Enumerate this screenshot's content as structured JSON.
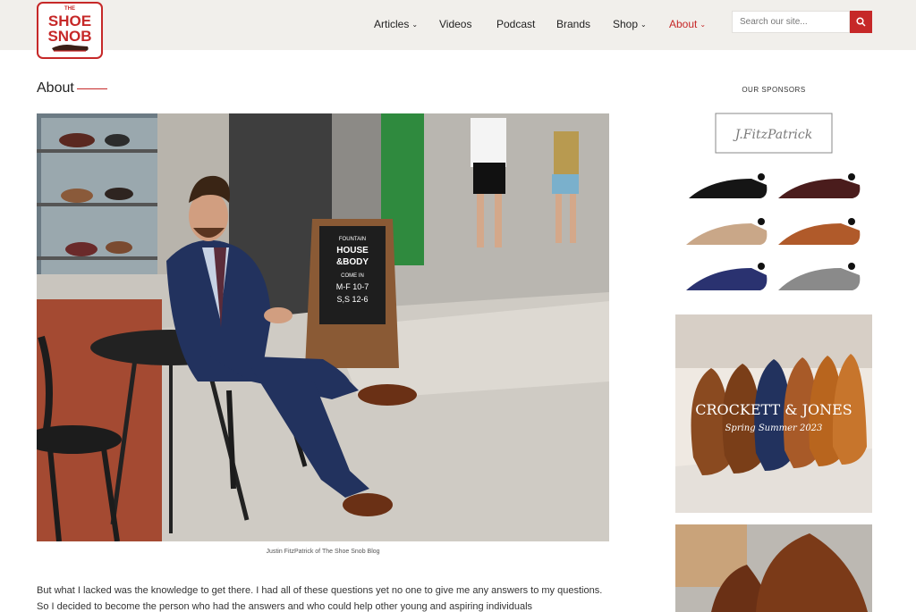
{
  "header": {
    "logo_text_top": "THE",
    "logo_text_main_1": "SHOE",
    "logo_text_main_2": "SNOB",
    "nav": [
      {
        "label": "Articles",
        "has_caret": true,
        "active": false
      },
      {
        "label": "Videos",
        "has_caret": false,
        "active": false
      },
      {
        "label": "Podcast",
        "has_caret": false,
        "active": false
      },
      {
        "label": "Brands",
        "has_caret": false,
        "active": false
      },
      {
        "label": "Shop",
        "has_caret": true,
        "active": false
      },
      {
        "label": "About",
        "has_caret": true,
        "active": true
      }
    ],
    "search": {
      "placeholder": "Search our site...",
      "icon": "search-icon"
    }
  },
  "page": {
    "title": "About",
    "hero": {
      "sign_lines": [
        "FOUNTAIN",
        "HOUSE",
        "&BODY",
        "COME IN",
        "M-F 10-7",
        "S,S 12-6"
      ]
    },
    "caption": "Justin FitzPatrick of The Shoe Snob Blog",
    "body_text": "But what I lacked was the knowledge to get there. I had all of these questions yet no one to give me any answers to my questions. So I decided to become the person who had the answers and who could help other young and aspiring individuals"
  },
  "sidebar": {
    "label": "OUR SPONSORS",
    "ad1": {
      "brand": "J.FitzPatrick"
    },
    "ad2": {
      "brand": "CROCKETT & JONES",
      "season": "Spring Summer 2023"
    }
  },
  "colors": {
    "accent": "#c62828",
    "header_bg": "#f1efeb",
    "text": "#222222"
  }
}
